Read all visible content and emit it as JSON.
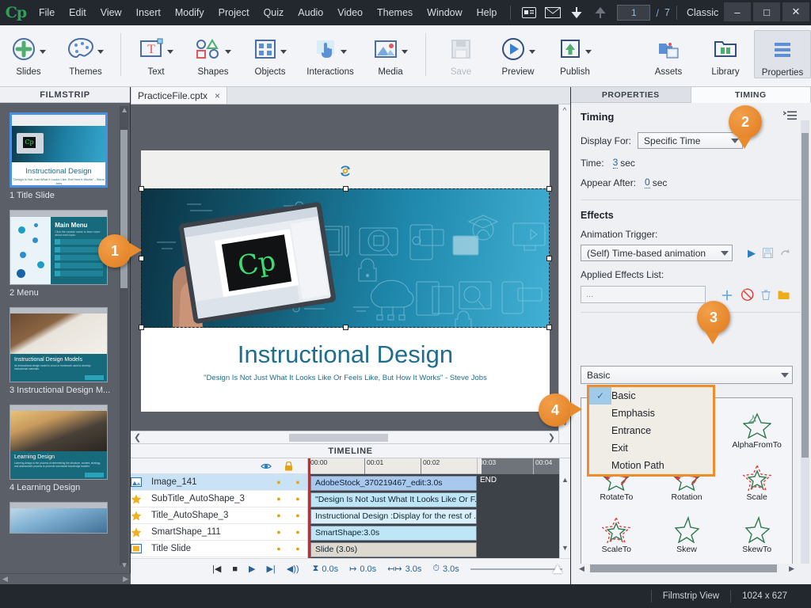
{
  "app": {
    "logo": "Cp",
    "menus": [
      "File",
      "Edit",
      "View",
      "Insert",
      "Modify",
      "Project",
      "Quiz",
      "Audio",
      "Video",
      "Themes",
      "Window",
      "Help"
    ],
    "slide_current": "1",
    "slash": "/",
    "slide_total": "7",
    "workspace": "Classic",
    "window_buttons": {
      "minimize": "–",
      "maximize": "□",
      "close": "✕"
    }
  },
  "ribbon": {
    "groups": [
      {
        "items": [
          {
            "label": "Slides",
            "icon": "plus-circle-icon",
            "caret": true
          },
          {
            "label": "Themes",
            "icon": "palette-icon",
            "caret": true
          }
        ]
      },
      {
        "items": [
          {
            "label": "Text",
            "icon": "text-box-icon",
            "caret": true
          },
          {
            "label": "Shapes",
            "icon": "shapes-icon",
            "caret": true
          },
          {
            "label": "Objects",
            "icon": "objects-grid-icon",
            "caret": true
          },
          {
            "label": "Interactions",
            "icon": "hand-pointer-icon",
            "caret": true
          },
          {
            "label": "Media",
            "icon": "image-icon",
            "caret": true
          }
        ]
      },
      {
        "items": [
          {
            "label": "Save",
            "icon": "floppy-disk-icon",
            "caret": false,
            "disabled": true
          },
          {
            "label": "Preview",
            "icon": "play-circle-icon",
            "caret": true
          },
          {
            "label": "Publish",
            "icon": "publish-upload-icon",
            "caret": true
          }
        ]
      },
      {
        "items": [
          {
            "label": "Assets",
            "icon": "assets-icon",
            "caret": false
          },
          {
            "label": "Library",
            "icon": "library-folder-icon",
            "caret": false
          },
          {
            "label": "Properties",
            "icon": "properties-lines-icon",
            "caret": false,
            "selected": true
          }
        ]
      }
    ]
  },
  "filmstrip": {
    "header": "FILMSTRIP",
    "slides": [
      {
        "caption": "1 Title Slide",
        "kind": "title",
        "active": true,
        "thumb_title": "Instructional Design",
        "thumb_sub": "\"Design Is Not Just What It Looks Like, But How It Works\" - Steve Jobs"
      },
      {
        "caption": "2 Menu",
        "kind": "menu",
        "active": false,
        "thumb_title": "Main Menu",
        "thumb_sub": "Click the module name to learn more about each topic."
      },
      {
        "caption": "3 Instructional Design M...",
        "kind": "photo",
        "active": false,
        "thumb_title": "Instructional Design Models",
        "thumb_sub": "An instructional design model is a tool or framework used to develop instructional materials."
      },
      {
        "caption": "4 Learning Design",
        "kind": "photo",
        "active": false,
        "thumb_title": "Learning Design",
        "thumb_sub": "Learning design is the process of determining the structure, content, strategy, and assessment process to promote successful knowledge transfer."
      },
      {
        "caption": "",
        "kind": "photo",
        "active": false,
        "thumb_title": "",
        "thumb_sub": ""
      }
    ]
  },
  "stage": {
    "tab_name": "PracticeFile.cptx",
    "tab_close": "×",
    "slide_title": "Instructional Design",
    "slide_subtitle": "\"Design Is Not Just What It Looks Like Or Feels Like, But How It Works\" - Steve Jobs",
    "image_brand": "Cp"
  },
  "timeline": {
    "header": "TIMELINE",
    "eye_icon": "eye-icon",
    "lock_icon": "lock-icon",
    "ruler_ticks": [
      "00:00",
      "00:01",
      "00:02",
      "00:03",
      "00:04"
    ],
    "end_label": "END",
    "rows": [
      {
        "icon": "image-object-icon",
        "name": "Image_141",
        "bar": "AdobeStock_370219467_edit:3.0s",
        "selected": true,
        "bar_color": "#a8c8ee"
      },
      {
        "icon": "star-icon",
        "name": "SubTitle_AutoShape_3",
        "bar": "\"Design Is Not Just What It Looks Like Or F...",
        "selected": false,
        "bar_color": "#bfe6f7"
      },
      {
        "icon": "star-icon",
        "name": "Title_AutoShape_3",
        "bar": "Instructional Design :Display for the rest of ...",
        "selected": false,
        "bar_color": "#d9f0fb"
      },
      {
        "icon": "star-icon",
        "name": "SmartShape_111",
        "bar": "SmartShape:3.0s",
        "selected": false,
        "bar_color": "#bfe6f7"
      },
      {
        "icon": "slide-icon",
        "name": "Title Slide",
        "bar": "Slide (3.0s)",
        "selected": false,
        "bar_color": "#ddd9cf"
      }
    ],
    "controls": [
      "start-icon",
      "stop-icon",
      "play-icon",
      "end-icon",
      "audio-icon"
    ],
    "stats": [
      {
        "icon": "hourglass-icon",
        "value": "0.0s"
      },
      {
        "icon": "start-arrow-icon",
        "value": "0.0s"
      },
      {
        "icon": "span-arrow-icon",
        "value": "3.0s"
      },
      {
        "icon": "stopwatch-icon",
        "value": "3.0s"
      }
    ]
  },
  "properties_panel": {
    "tabs": [
      {
        "label": "PROPERTIES",
        "active": false
      },
      {
        "label": "TIMING",
        "active": true
      }
    ],
    "timing": {
      "heading": "Timing",
      "display_for_label": "Display For:",
      "display_for_value": "Specific Time",
      "time_label": "Time:",
      "time_value": "3",
      "time_unit": "sec",
      "appear_after_label": "Appear After:",
      "appear_after_value": "0",
      "appear_after_unit": "sec",
      "menu_icon": "panel-menu-icon"
    },
    "effects": {
      "heading": "Effects",
      "animation_trigger_label": "Animation Trigger:",
      "animation_trigger_value": "(Self) Time-based animation",
      "trigger_icons": [
        "play-icon",
        "save-icon",
        "redo-icon"
      ],
      "applied_effects_label": "Applied Effects List:",
      "applied_effects_value": "...",
      "applied_icons": [
        "add-icon",
        "disable-icon",
        "delete-icon",
        "folder-icon"
      ],
      "category_value": "Basic",
      "category_options": [
        {
          "label": "Basic",
          "checked": true
        },
        {
          "label": "Emphasis",
          "checked": false
        },
        {
          "label": "Entrance",
          "checked": false
        },
        {
          "label": "Exit",
          "checked": false
        },
        {
          "label": "Motion Path",
          "checked": false
        }
      ],
      "grid": [
        {
          "label": "AlphaFromTo",
          "icon": "star-plain-icon",
          "row": 0,
          "col": 2
        },
        {
          "label": "RotateTo",
          "icon": "star-rotate-icon",
          "row": 1,
          "col": 0
        },
        {
          "label": "Rotation",
          "icon": "star-rotate-icon",
          "row": 1,
          "col": 1
        },
        {
          "label": "Scale",
          "icon": "star-dashed-icon",
          "row": 1,
          "col": 2
        },
        {
          "label": "ScaleTo",
          "icon": "star-dashed-icon",
          "row": 2,
          "col": 0
        },
        {
          "label": "Skew",
          "icon": "star-plain-icon",
          "row": 2,
          "col": 1
        },
        {
          "label": "SkewTo",
          "icon": "star-plain-icon",
          "row": 2,
          "col": 2
        }
      ]
    }
  },
  "callouts": [
    {
      "number": "1",
      "tail": "right"
    },
    {
      "number": "2",
      "tail": "down"
    },
    {
      "number": "3",
      "tail": "down"
    },
    {
      "number": "4",
      "tail": "right"
    }
  ],
  "statusbar": {
    "view_mode": "Filmstrip View",
    "dimensions": "1024 x 627"
  },
  "colors": {
    "accent_orange": "#e88a2e",
    "brand_green": "#2fa05a",
    "teal_text": "#1e6e90",
    "blue_link": "#2a6496",
    "selection_blue": "#4a90e2"
  }
}
